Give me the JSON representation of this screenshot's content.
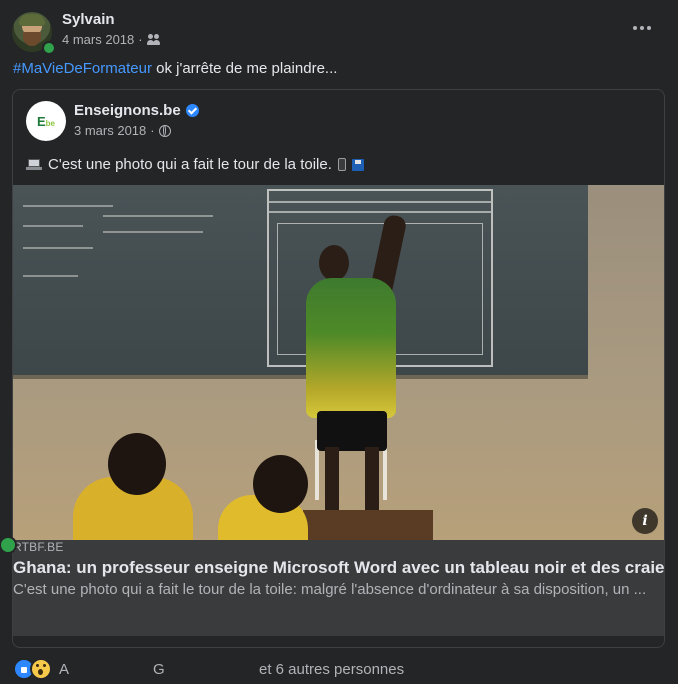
{
  "post": {
    "author": "Sylvain",
    "date": "4 mars 2018",
    "audience_icon": "friends-icon",
    "hashtag": "#MaVieDeFormateur",
    "text": " ok j'arrête de me plaindre..."
  },
  "shared_post": {
    "page_name": "Enseignons.be",
    "page_logo": "E.be",
    "date": "3 mars 2018",
    "audience_icon": "globe-icon",
    "text": "C'est une photo qui a fait le tour de la toile."
  },
  "link": {
    "domain": "RTBF.BE",
    "title": "Ghana: un professeur enseigne Microsoft Word avec un tableau noir et des craies",
    "description": "C'est une photo qui a fait le tour de la toile: malgré l'absence d'ordinateur à sa disposition, un ..."
  },
  "reactions": {
    "name_a": "A",
    "name_g": "G",
    "others": "et 6 autres personnes"
  },
  "colors": {
    "background": "#242526",
    "link": "#4599ff",
    "verified": "#2d88ff",
    "online": "#31a24c"
  }
}
